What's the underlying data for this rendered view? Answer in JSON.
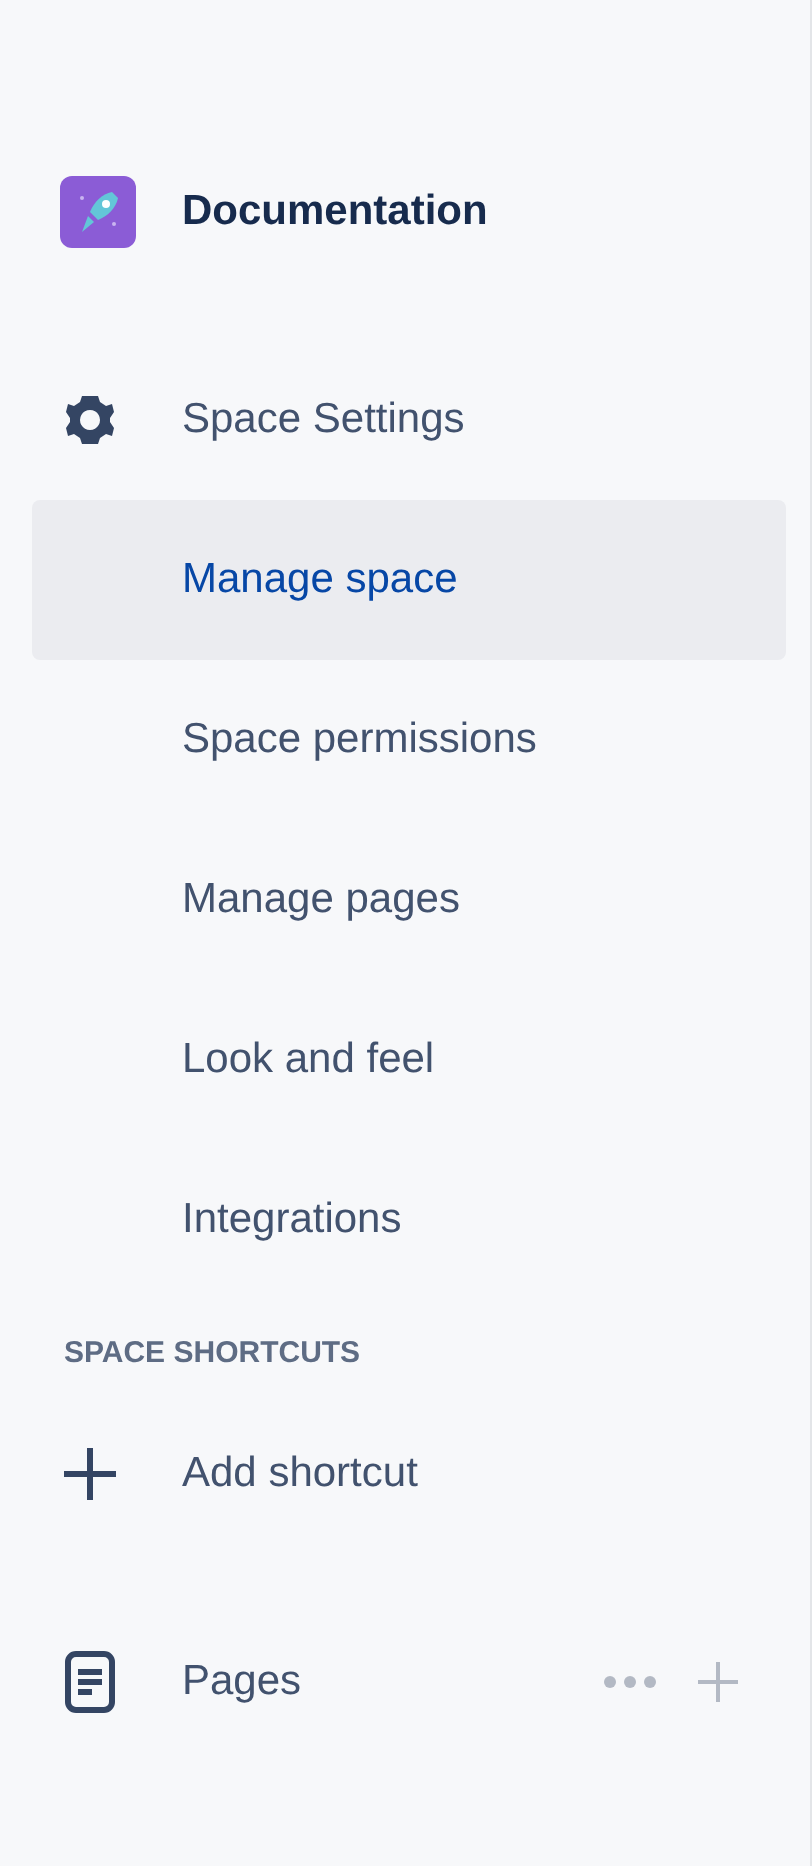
{
  "space": {
    "name": "Documentation"
  },
  "settings": {
    "label": "Space Settings",
    "items": [
      {
        "label": "Manage space",
        "selected": true
      },
      {
        "label": "Space permissions",
        "selected": false
      },
      {
        "label": "Manage pages",
        "selected": false
      },
      {
        "label": "Look and feel",
        "selected": false
      },
      {
        "label": "Integrations",
        "selected": false
      }
    ]
  },
  "shortcuts": {
    "heading": "SPACE SHORTCUTS",
    "add_label": "Add shortcut"
  },
  "pages": {
    "label": "Pages"
  }
}
